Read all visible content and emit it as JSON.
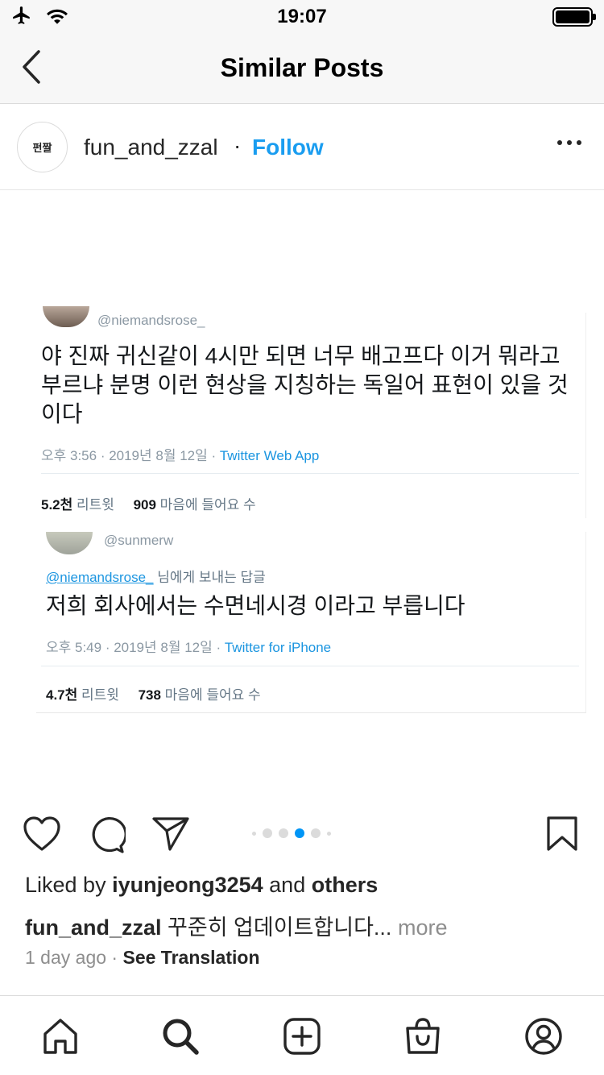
{
  "status_bar": {
    "time": "19:07"
  },
  "nav": {
    "title": "Similar Posts"
  },
  "post": {
    "avatar_text": "펀짤",
    "username": "fun_and_zzal",
    "separator": "·",
    "follow_label": "Follow"
  },
  "tweets": [
    {
      "handle": "@niemandsrose_",
      "body": "야 진짜 귀신같이 4시만 되면 너무 배고프다 이거 뭐라고 부르냐 분명 이런 현상을 지칭하는 독일어 표현이 있을 것이다",
      "meta_time": "오후 3:56 · 2019년 8월 12일 · ",
      "meta_app": "Twitter Web App",
      "retweets": "5.2천",
      "retweets_label": "리트윗",
      "likes": "909",
      "likes_label": "마음에 들어요 수"
    },
    {
      "handle": "@sunmerw",
      "reply_mention": "@niemandsrose_",
      "reply_suffix": " 님에게 보내는 답글",
      "body": "저희 회사에서는 수면네시경 이라고 부릅니다",
      "meta_time": "오후 5:49 · 2019년 8월 12일 · ",
      "meta_app": "Twitter for iPhone",
      "retweets": "4.7천",
      "retweets_label": "리트윗",
      "likes": "738",
      "likes_label": "마음에 들어요 수"
    }
  ],
  "carousel": {
    "count": 6,
    "active_index": 3
  },
  "caption": {
    "liked_prefix": "Liked by ",
    "liked_user": "iyunjeong3254",
    "liked_and": " and ",
    "liked_others": "others",
    "author": "fun_and_zzal",
    "text": " 꾸준히 업데이트합니다...",
    "more": " more",
    "time_ago": "1 day ago",
    "dot": " · ",
    "see_translation": "See Translation"
  },
  "icons": {
    "back": "chevron-left-icon",
    "more": "more-horizontal-icon",
    "like": "heart-icon",
    "comment": "comment-icon",
    "share": "paper-plane-icon",
    "save": "bookmark-icon",
    "home": "home-icon",
    "search": "search-icon",
    "create": "plus-square-icon",
    "shop": "shopping-bag-icon",
    "profile": "profile-icon"
  },
  "colors": {
    "accent": "#0095f6",
    "follow": "#1a9df0",
    "twitter_link": "#1b95e0"
  }
}
